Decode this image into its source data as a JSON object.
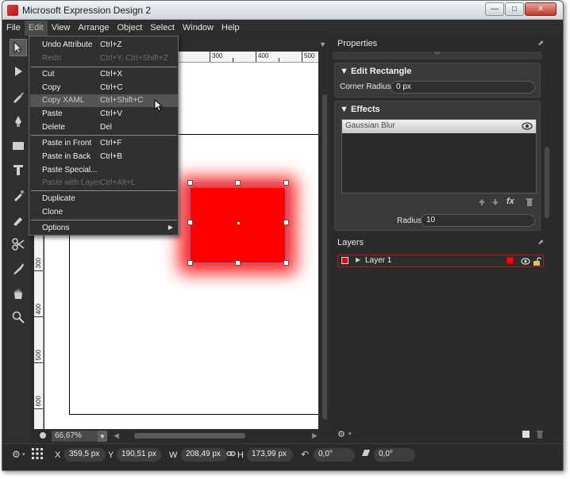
{
  "app": {
    "title": "Microsoft Expression Design 2"
  },
  "window_buttons": {
    "minimize": "—",
    "maximize": "□",
    "close": "✕"
  },
  "menubar": [
    "File",
    "Edit",
    "View",
    "Arrange",
    "Object",
    "Select",
    "Window",
    "Help"
  ],
  "edit_menu": [
    {
      "label": "Undo Attribute",
      "shortcut": "Ctrl+Z",
      "state": "enabled"
    },
    {
      "label": "Redo",
      "shortcut": "Ctrl+Y, Ctrl+Shift+Z",
      "state": "disabled"
    },
    {
      "label": "Cut",
      "shortcut": "Ctrl+X",
      "state": "enabled"
    },
    {
      "label": "Copy",
      "shortcut": "Ctrl+C",
      "state": "enabled"
    },
    {
      "label": "Copy XAML",
      "shortcut": "Ctrl+Shift+C",
      "state": "highlighted"
    },
    {
      "label": "Paste",
      "shortcut": "Ctrl+V",
      "state": "enabled"
    },
    {
      "label": "Delete",
      "shortcut": "Del",
      "state": "enabled"
    },
    {
      "label": "Paste in Front",
      "shortcut": "Ctrl+F",
      "state": "enabled"
    },
    {
      "label": "Paste in Back",
      "shortcut": "Ctrl+B",
      "state": "enabled"
    },
    {
      "label": "Paste Special...",
      "shortcut": "",
      "state": "enabled"
    },
    {
      "label": "Paste with Layer",
      "shortcut": "Ctrl+Alt+L",
      "state": "disabled"
    },
    {
      "label": "Duplicate",
      "shortcut": "",
      "state": "enabled"
    },
    {
      "label": "Clone",
      "shortcut": "",
      "state": "enabled"
    },
    {
      "label": "Options",
      "shortcut": "",
      "state": "submenu"
    }
  ],
  "tools": [
    "selection-tool",
    "direct-selection-tool",
    "pen-tool",
    "brush-tool",
    "rectangle-tool",
    "text-tool",
    "eyedropper-tool",
    "paint-tool",
    "scissors-tool",
    "dropper-tool",
    "hand-tool",
    "zoom-tool"
  ],
  "rulers": {
    "top": [
      "300",
      "400",
      "500"
    ],
    "left": [
      "300",
      "400",
      "500",
      "600"
    ]
  },
  "doc": {
    "zoom": "66,67%"
  },
  "properties": {
    "panel_title": "Properties",
    "edit_rectangle": {
      "title": "Edit Rectangle",
      "corner_radius_label": "Corner Radius",
      "corner_radius_value": "0 px"
    },
    "effects": {
      "title": "Effects",
      "items": [
        "Gaussian Blur"
      ],
      "radius_label": "Radius",
      "radius_value": "10",
      "fx_label": "fx"
    }
  },
  "layers": {
    "panel_title": "Layers",
    "items": [
      {
        "name": "Layer 1",
        "color": "#ff0000"
      }
    ]
  },
  "statusbar": {
    "x_label": "X",
    "x_value": "359,5 px",
    "y_label": "Y",
    "y_value": "190,51 px",
    "w_label": "W",
    "w_value": "208,49 px",
    "h_label": "H",
    "h_value": "173,99 px",
    "rotation_value": "0,0°",
    "skew_value": "0,0°"
  }
}
